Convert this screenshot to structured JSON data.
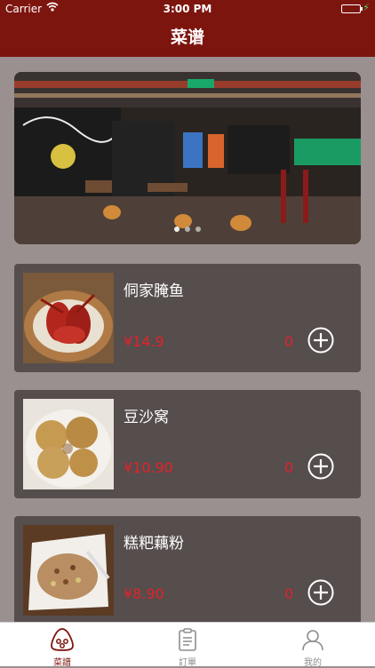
{
  "status_bar": {
    "carrier": "Carrier",
    "time": "3:00 PM"
  },
  "nav": {
    "title": "菜谱"
  },
  "banner": {
    "page_count": 3,
    "active_page": 1
  },
  "menu_items": [
    {
      "name": "侗家腌鱼",
      "price": "¥14.9",
      "quantity": "0"
    },
    {
      "name": "豆沙窝",
      "price": "¥10.90",
      "quantity": "0"
    },
    {
      "name": "糕粑藕粉",
      "price": "¥8.90",
      "quantity": "0"
    }
  ],
  "tab_bar": {
    "tabs": [
      {
        "label": "菜譜",
        "icon": "rice-ball-icon",
        "active": true
      },
      {
        "label": "訂單",
        "icon": "clipboard-icon",
        "active": false
      },
      {
        "label": "我的",
        "icon": "user-icon",
        "active": false
      }
    ]
  },
  "colors": {
    "nav_background": "#7d150f",
    "card_background": "#564d4d",
    "price_red": "#e3222a",
    "page_background": "#9a9090"
  }
}
